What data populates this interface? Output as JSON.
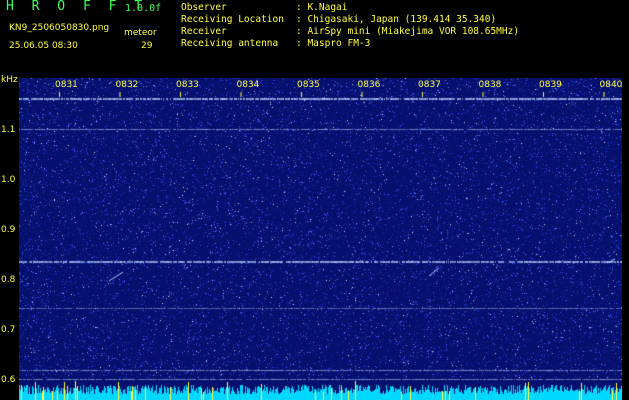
{
  "app": {
    "title": "H R O F F T",
    "version": "1.0.0f"
  },
  "file": {
    "name": "KN9_2506050830.png",
    "datetime": "25.06.05 08:30"
  },
  "meteor": {
    "label": "meteor",
    "count": "29"
  },
  "meta": [
    {
      "label": "Observer",
      "value": ": K.Nagai"
    },
    {
      "label": "Receiving Location",
      "value": ": Chigasaki, Japan (139.414 35.340)"
    },
    {
      "label": "Receiver",
      "value": ": AirSpy mini (Miakejima VOR 108.65MHz)"
    },
    {
      "label": "Receiving antenna",
      "value": ": Maspro FM-3"
    }
  ],
  "spectrogram": {
    "unit_label": "kHz",
    "time_ticks": [
      "0831",
      "0832",
      "0833",
      "0834",
      "0835",
      "0836",
      "0837",
      "0838",
      "0839",
      "0840"
    ],
    "freq_ticks": [
      "1.1",
      "1.0",
      "0.9",
      "0.8",
      "0.7",
      "0.6"
    ],
    "colors": {
      "background": "#06106e",
      "noise": "#3a55ff",
      "line": "#b8d4ff",
      "tick": "#ffff40",
      "bottom": "#00d8ff"
    }
  }
}
